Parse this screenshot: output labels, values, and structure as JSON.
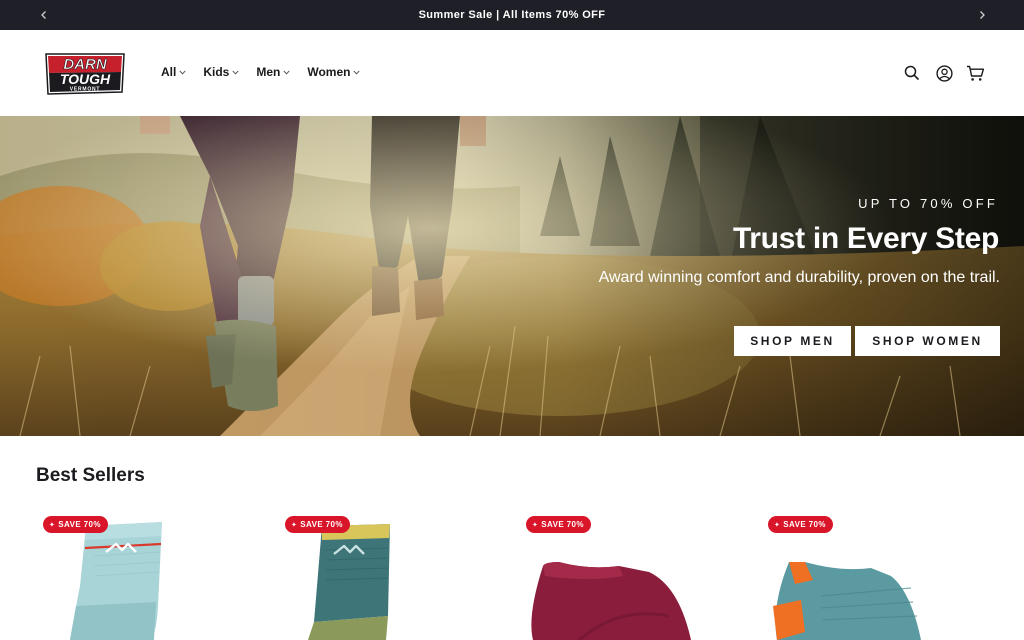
{
  "announcement": {
    "text": "Summer Sale | All Items 70% OFF",
    "prev_icon": "chevron-left-icon",
    "next_icon": "chevron-right-icon"
  },
  "header": {
    "logo": {
      "line1": "DARN",
      "line2": "TOUGH",
      "line3": "VERMONT"
    },
    "nav": [
      {
        "label": "All"
      },
      {
        "label": "Kids"
      },
      {
        "label": "Men"
      },
      {
        "label": "Women"
      }
    ],
    "icons": [
      "search-icon",
      "account-icon",
      "cart-icon"
    ]
  },
  "hero": {
    "kicker": "UP TO 70% OFF",
    "title": "Trust in Every Step",
    "subtitle": "Award winning comfort and durability, proven on the trail.",
    "buttons": {
      "men": "SHOP MEN",
      "women": "SHOP WOMEN"
    }
  },
  "best_sellers": {
    "title": "Best Sellers",
    "products": [
      {
        "badge": "SAVE 70%",
        "color": "#9fd0d4"
      },
      {
        "badge": "SAVE 70%",
        "color": "#3d7578"
      },
      {
        "badge": "SAVE 70%",
        "color": "#8a1d3c"
      },
      {
        "badge": "SAVE 70%",
        "color": "#5a9aa0"
      }
    ]
  },
  "colors": {
    "announcement_bg": "#1f1f27",
    "badge_red": "#d9152a",
    "text_dark": "#1b1b1f"
  }
}
